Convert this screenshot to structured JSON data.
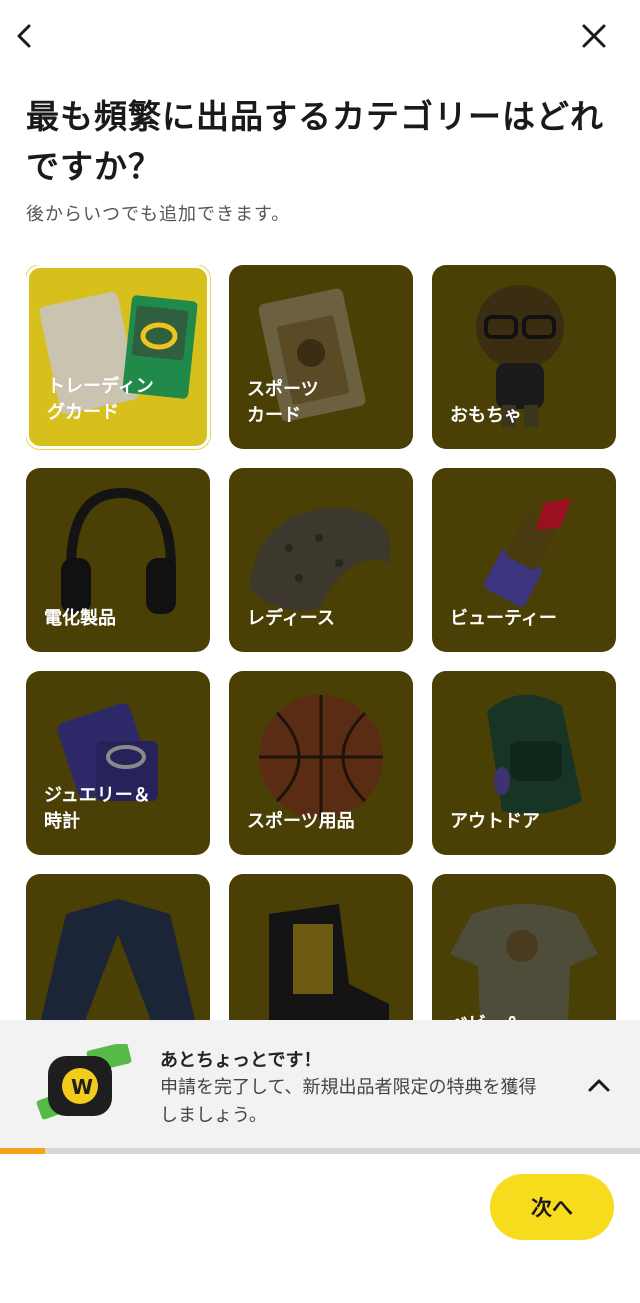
{
  "header": {
    "back_icon": "chevron-left-icon",
    "close_icon": "close-icon"
  },
  "title": "最も頻繁に出品するカテゴリーはどれですか？",
  "subtitle": "後からいつでも追加できます。",
  "categories": [
    {
      "label": "トレーディン\nグカード",
      "icon": "trading-card-icon",
      "selected": true
    },
    {
      "label": "スポーツ\nカード",
      "icon": "sports-card-icon",
      "selected": false
    },
    {
      "label": "おもちゃ",
      "icon": "toy-figure-icon",
      "selected": false
    },
    {
      "label": "電化製品",
      "icon": "headphones-icon",
      "selected": false
    },
    {
      "label": "レディース",
      "icon": "knit-hat-icon",
      "selected": false
    },
    {
      "label": "ビューティー",
      "icon": "lipstick-icon",
      "selected": false
    },
    {
      "label": "ジュエリー＆\n時計",
      "icon": "ring-box-icon",
      "selected": false
    },
    {
      "label": "スポーツ用品",
      "icon": "basketball-icon",
      "selected": false
    },
    {
      "label": "アウトドア",
      "icon": "backpack-icon",
      "selected": false
    },
    {
      "label": "",
      "icon": "denim-jacket-icon",
      "selected": false
    },
    {
      "label": "",
      "icon": "sneaker-icon",
      "selected": false
    },
    {
      "label": "ベビー＆",
      "icon": "baby-onesie-icon",
      "selected": false
    }
  ],
  "banner": {
    "title": "あとちょっとです！",
    "text": "申請を完了して、新規出品者限定の特典を獲得しましょう。",
    "icon": "money-reward-icon",
    "chevron_icon": "chevron-up-icon"
  },
  "progress": {
    "value": 0.07,
    "color": "#f2a316"
  },
  "next_button": {
    "label": "次へ"
  },
  "colors": {
    "accent": "#f7dc1e",
    "tile_bg": "#4a3f05",
    "tile_selected": "#d8c01c"
  }
}
